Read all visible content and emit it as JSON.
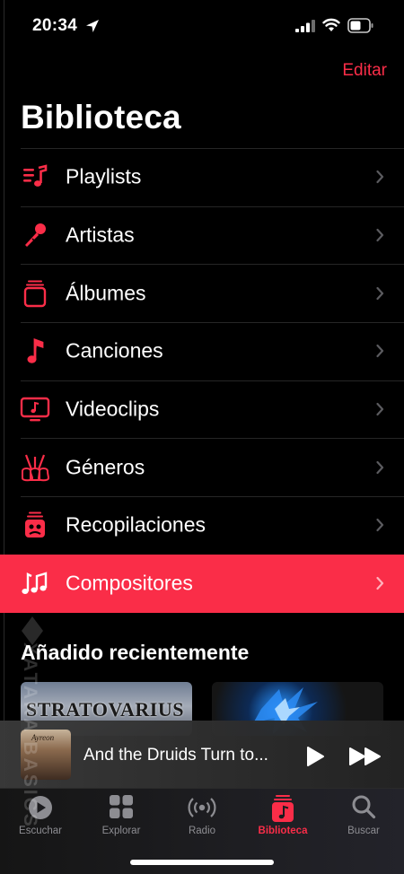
{
  "status_bar": {
    "time": "20:34"
  },
  "header": {
    "edit_label": "Editar",
    "title": "Biblioteca"
  },
  "library_items": [
    {
      "label": "Playlists",
      "icon": "playlist-icon"
    },
    {
      "label": "Artistas",
      "icon": "microphone-icon"
    },
    {
      "label": "Álbumes",
      "icon": "album-stack-icon"
    },
    {
      "label": "Canciones",
      "icon": "music-note-icon"
    },
    {
      "label": "Videoclips",
      "icon": "tv-music-icon"
    },
    {
      "label": "Géneros",
      "icon": "guitars-icon"
    },
    {
      "label": "Recopilaciones",
      "icon": "compilation-icon"
    },
    {
      "label": "Compositores",
      "icon": "composer-notes-icon",
      "selected": true
    }
  ],
  "recent": {
    "title": "Añadido recientemente",
    "albums": [
      {
        "art_text": "STRATOVARIUS"
      },
      {
        "art_text": ""
      }
    ]
  },
  "mini_player": {
    "track_title": "And the Druids Turn to...",
    "art_text": "Ayreon"
  },
  "tabs": [
    {
      "label": "Escuchar",
      "icon": "play-circle-icon"
    },
    {
      "label": "Explorar",
      "icon": "grid-icon"
    },
    {
      "label": "Radio",
      "icon": "radio-waves-icon"
    },
    {
      "label": "Biblioteca",
      "icon": "library-note-icon",
      "active": true
    },
    {
      "label": "Buscar",
      "icon": "search-icon"
    }
  ],
  "watermark": {
    "text": "XATAKA BASICS"
  },
  "colors": {
    "accent": "#fa2d48",
    "background": "#000000",
    "separator": "#262626",
    "tab_inactive": "#8d8d92"
  }
}
